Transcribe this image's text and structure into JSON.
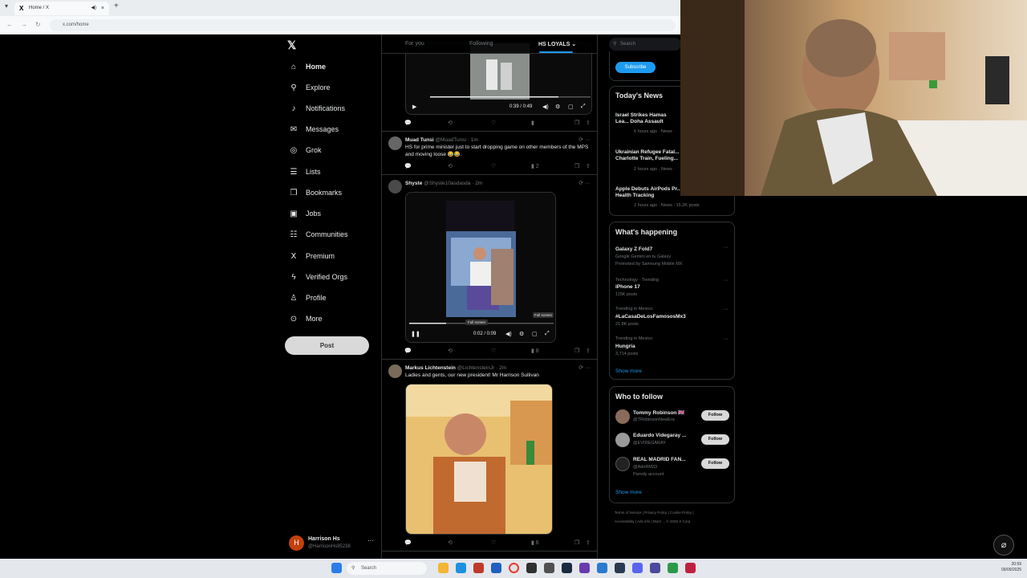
{
  "browser": {
    "tab_title": "Home / X",
    "url": "x.com/home"
  },
  "nav": {
    "items": [
      {
        "label": "Home",
        "icon": "home-icon",
        "glyph": "⌂"
      },
      {
        "label": "Explore",
        "icon": "search-icon",
        "glyph": "⚲"
      },
      {
        "label": "Notifications",
        "icon": "bell-icon",
        "glyph": "♪"
      },
      {
        "label": "Messages",
        "icon": "mail-icon",
        "glyph": "✉"
      },
      {
        "label": "Grok",
        "icon": "grok-icon",
        "glyph": "◎"
      },
      {
        "label": "Lists",
        "icon": "list-icon",
        "glyph": "☰"
      },
      {
        "label": "Bookmarks",
        "icon": "bookmark-icon",
        "glyph": "❒"
      },
      {
        "label": "Jobs",
        "icon": "briefcase-icon",
        "glyph": "▣"
      },
      {
        "label": "Communities",
        "icon": "people-icon",
        "glyph": "☷"
      },
      {
        "label": "Premium",
        "icon": "x-icon",
        "glyph": "X"
      },
      {
        "label": "Verified Orgs",
        "icon": "lightning-icon",
        "glyph": "ϟ"
      },
      {
        "label": "Profile",
        "icon": "person-icon",
        "glyph": "♙"
      },
      {
        "label": "More",
        "icon": "more-circle-icon",
        "glyph": "⊙"
      }
    ],
    "post_label": "Post",
    "account": {
      "initial": "H",
      "name": "Harrison Hs",
      "handle": "@HarrisonHs95238"
    }
  },
  "feed": {
    "tabs": [
      {
        "label": "For you"
      },
      {
        "label": "Following"
      },
      {
        "label": "HS LOYALS ⌄"
      }
    ],
    "video1_time": "0:39 / 0:49",
    "tweets": [
      {
        "name": "Muad Tunsi",
        "meta": "@MuadTunsi · 1m",
        "text": "HS for prime minister just to start dropping game on other members of the MPS and moving loose 😂😂.",
        "views": "2"
      },
      {
        "name": "Shyste",
        "meta": "@Shyste10asdasda · 2m",
        "video_time": "0:02 / 0:09",
        "tooltip": "Full screen",
        "views": "8"
      },
      {
        "name": "Markus Lichtenstein",
        "meta": "@LichtensteinJr · 2m",
        "text": "Ladies and gents, our new president! Mr Harrison Sullivan",
        "views": "6"
      }
    ]
  },
  "right": {
    "search_placeholder": "Search",
    "subscribe_label": "Subscribe",
    "news_title": "Today's News",
    "news": [
      {
        "title": "Israel Strikes Hamas Lea... Doha Assault",
        "meta": "6 hours ago · News ·"
      },
      {
        "title": "Ukrainian Refugee Fatal... Charlotte Train, Fueling...",
        "meta": "2 hours ago · News ·"
      },
      {
        "title": "Apple Debuts AirPods Pr... Translation and Health Tracking",
        "meta": "2 hours ago · News · 15.2K posts"
      }
    ],
    "happening_title": "What's happening",
    "trends": [
      {
        "context": "",
        "name": "Galaxy Z Fold7",
        "sub": "Google Gemini en tu Galaxy",
        "posts": "Promoted by Samsung Mobile MX"
      },
      {
        "context": "Technology · Trending",
        "name": "iPhone 17",
        "sub": "",
        "posts": "115K posts"
      },
      {
        "context": "Trending in Mexico",
        "name": "#LaCasaDeLosFamososMx3",
        "sub": "",
        "posts": "21.8K posts"
      },
      {
        "context": "Trending in Mexico",
        "name": "Hungría",
        "sub": "",
        "posts": "3,714 posts"
      }
    ],
    "show_more": "Show more",
    "who_title": "Who to follow",
    "who": [
      {
        "name": "Tommy Robinson 🇬🇧",
        "handle": "@TRobinsonNewEra",
        "extra": ""
      },
      {
        "name": "Eduardo Videgaray ...",
        "handle": "@EVIDEGARAY",
        "extra": ""
      },
      {
        "name": "REAL MADRID FAN...",
        "handle": "@AdriRM33",
        "extra": "Parody account"
      }
    ],
    "follow_label": "Follow",
    "footer": [
      "Terms of Service",
      "Privacy Policy",
      "Cookie Policy",
      "Accessibility",
      "Ads info",
      "More ...",
      "© 2025 X Corp."
    ]
  },
  "taskbar": {
    "search_label": "Search",
    "time": "20:59",
    "date": "09/09/2025"
  }
}
